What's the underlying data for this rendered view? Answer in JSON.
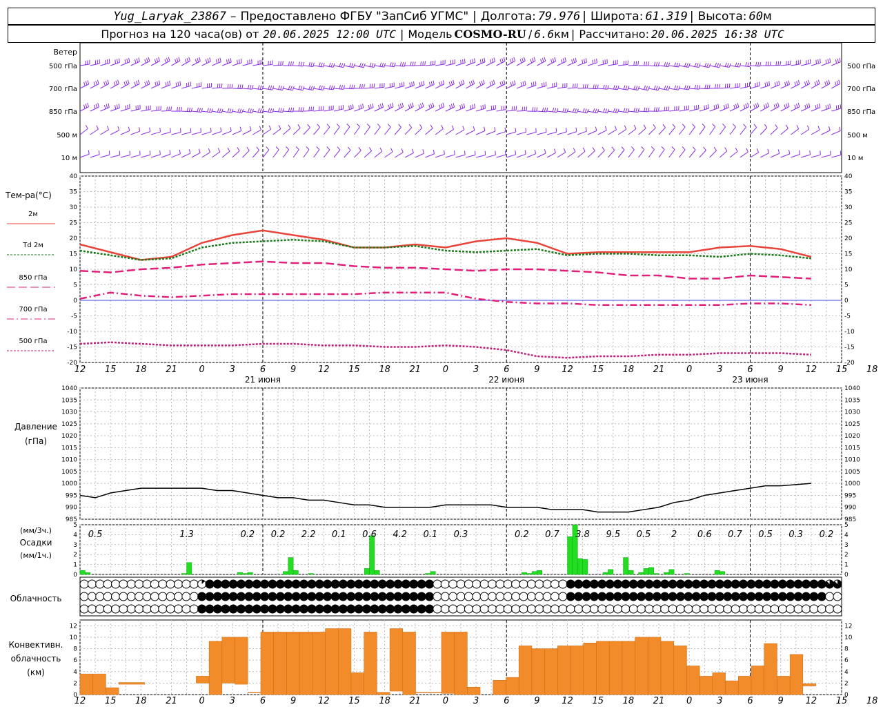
{
  "header": {
    "station": "Yug_Laryak_23867",
    "dash": "–",
    "provider": "Предоставлено ФГБУ \"ЗапСиб УГМС\"",
    "lon_label": "Долгота:",
    "lon_value": "79.976",
    "lat_label": "Широта:",
    "lat_value": "61.319",
    "alt_label": "Высота:",
    "alt_value": "60",
    "alt_unit": "м",
    "forecast_label": "Прогноз на 120 часа(ов) от",
    "forecast_from": "20.06.2025 12:00 UTC",
    "model_label": "Модель",
    "model_name": "COSMO-RU",
    "model_res": "6.6",
    "model_res_unit": "км",
    "calc_label": "Рассчитано:",
    "calc_value": "20.06.2025 16:38 UTC",
    "sep": "|"
  },
  "chart_data": [
    {
      "type": "wind-barbs",
      "panel_label": "Ветер",
      "levels": [
        "500 гПа",
        "700 гПа",
        "850 гПа",
        "500 м",
        "10 м"
      ]
    },
    {
      "type": "line",
      "panel_label": "Тем-ра(°C)",
      "ylim": [
        -20,
        40
      ],
      "yticks": [
        -20,
        -15,
        -10,
        -5,
        0,
        5,
        10,
        15,
        20,
        25,
        30,
        35,
        40
      ],
      "x_hour_labels": [
        "12",
        "15",
        "18",
        "21",
        "0",
        "3",
        "6",
        "9",
        "12",
        "15",
        "18",
        "21",
        "0",
        "3",
        "6",
        "9",
        "12",
        "15",
        "18",
        "21",
        "0",
        "3",
        "6",
        "9",
        "12",
        "15",
        "18"
      ],
      "date_labels": [
        {
          "text": "21 июня",
          "x": 36
        },
        {
          "text": "22 июня",
          "x": 84
        },
        {
          "text": "23 июня",
          "x": 132
        }
      ],
      "series": [
        {
          "name": "2м",
          "color": "#e8443a",
          "dash": "solid",
          "x": [
            0,
            6,
            12,
            18,
            24,
            30,
            36,
            42,
            48,
            54,
            60,
            66,
            72,
            78,
            84,
            90,
            96,
            102,
            108,
            114,
            120,
            126,
            132,
            138,
            144
          ],
          "y": [
            18,
            15.5,
            13,
            14,
            18.5,
            21,
            22.5,
            21,
            19.5,
            17,
            17,
            18,
            17,
            19,
            20,
            18.5,
            15,
            15.5,
            15.5,
            15.5,
            15.5,
            17,
            17.5,
            16.5,
            14
          ]
        },
        {
          "name": "Td 2м",
          "color": "#1a7a1a",
          "dash": "3,2",
          "x": [
            0,
            6,
            12,
            18,
            24,
            30,
            36,
            42,
            48,
            54,
            60,
            66,
            72,
            78,
            84,
            90,
            96,
            102,
            108,
            114,
            120,
            126,
            132,
            138,
            144
          ],
          "y": [
            16,
            14.5,
            13,
            13.5,
            17,
            18.5,
            19,
            19.5,
            19,
            17,
            17,
            17.5,
            16,
            15.5,
            16,
            16.5,
            14.5,
            15,
            15,
            14.5,
            14.5,
            14,
            15,
            14.5,
            13.5
          ]
        },
        {
          "name": "850 гПа",
          "color": "#e0207a",
          "dash": "12,5",
          "x": [
            0,
            6,
            12,
            18,
            24,
            30,
            36,
            42,
            48,
            54,
            60,
            66,
            72,
            78,
            84,
            90,
            96,
            102,
            108,
            114,
            120,
            126,
            132,
            138,
            144
          ],
          "y": [
            9.5,
            9,
            10,
            10.5,
            11.5,
            12,
            12.5,
            12,
            12,
            11,
            10.5,
            10.5,
            10,
            9.5,
            10,
            10,
            9.5,
            9,
            8,
            8,
            7,
            7,
            8,
            7.5,
            7
          ]
        },
        {
          "name": "700 гПа",
          "color": "#e0207a",
          "dash": "10,4,2,4",
          "x": [
            0,
            6,
            12,
            18,
            24,
            30,
            36,
            42,
            48,
            54,
            60,
            66,
            72,
            78,
            84,
            90,
            96,
            102,
            108,
            114,
            120,
            126,
            132,
            138,
            144
          ],
          "y": [
            0.5,
            2.5,
            1.5,
            1,
            1.5,
            2,
            2,
            2,
            2,
            2,
            2.5,
            2.5,
            2.5,
            0.5,
            -0.5,
            -1,
            -1,
            -1.5,
            -1.5,
            -1.5,
            -1.5,
            -1.5,
            -1,
            -1,
            -1.5
          ]
        },
        {
          "name": "500 гПа",
          "color": "#c0207a",
          "dash": "3,2",
          "x": [
            0,
            6,
            12,
            18,
            24,
            30,
            36,
            42,
            48,
            54,
            60,
            66,
            72,
            78,
            84,
            90,
            96,
            102,
            108,
            114,
            120,
            126,
            132,
            138,
            144
          ],
          "y": [
            -14,
            -13.5,
            -14,
            -14.5,
            -14.5,
            -14.5,
            -14,
            -14,
            -14.5,
            -14.5,
            -15,
            -15,
            -14.5,
            -15,
            -16,
            -18,
            -18.5,
            -18,
            -18,
            -17.5,
            -17.5,
            -17,
            -17,
            -17,
            -17.5
          ]
        }
      ]
    },
    {
      "type": "line",
      "panel_label_1": "Давление",
      "panel_label_2": "(гПа)",
      "ylim": [
        985,
        1040
      ],
      "yticks": [
        985,
        990,
        995,
        1000,
        1005,
        1010,
        1015,
        1020,
        1025,
        1030,
        1035,
        1040
      ],
      "series": [
        {
          "name": "",
          "color": "#000000",
          "x": [
            0,
            3,
            6,
            9,
            12,
            15,
            18,
            21,
            24,
            27,
            30,
            33,
            36,
            39,
            42,
            45,
            48,
            51,
            54,
            57,
            60,
            63,
            66,
            69,
            72,
            75,
            78,
            81,
            84,
            87,
            90,
            93,
            96,
            99,
            102,
            105,
            108,
            111,
            114,
            117,
            120,
            123,
            126,
            129,
            132,
            135,
            138,
            141,
            144
          ],
          "y": [
            995,
            994,
            996,
            997,
            998,
            998,
            998,
            998,
            998,
            997,
            997,
            996,
            995,
            994,
            994,
            993,
            993,
            992,
            991,
            991,
            990,
            990,
            990,
            990,
            991,
            991,
            991,
            991,
            990,
            990,
            990,
            989,
            989,
            989,
            988,
            988,
            988,
            989,
            990,
            992,
            993,
            995,
            996,
            997,
            998,
            999,
            999,
            999.5,
            1000
          ]
        }
      ]
    },
    {
      "type": "bar",
      "panel_label_1": "(мм/3ч.)",
      "panel_label_2": "Осадки",
      "panel_label_3": "(мм/1ч.)",
      "ylim": [
        0,
        5
      ],
      "yticks": [
        0,
        1,
        2,
        3,
        4,
        5
      ],
      "totals_3h": [
        {
          "x": 3,
          "text": "0.5"
        },
        {
          "x": 21,
          "text": "1.3"
        },
        {
          "x": 33,
          "text": "0.2"
        },
        {
          "x": 39,
          "text": "0.2"
        },
        {
          "x": 45,
          "text": "2.2"
        },
        {
          "x": 51,
          "text": "0.1"
        },
        {
          "x": 57,
          "text": "0.6"
        },
        {
          "x": 63,
          "text": "4.2"
        },
        {
          "x": 69,
          "text": "0.1"
        },
        {
          "x": 75,
          "text": "0.3"
        },
        {
          "x": 87,
          "text": "0.2"
        },
        {
          "x": 93,
          "text": "0.7"
        },
        {
          "x": 99,
          "text": "3.8"
        },
        {
          "x": 105,
          "text": "9.5"
        },
        {
          "x": 111,
          "text": "0.5"
        },
        {
          "x": 117,
          "text": "2"
        },
        {
          "x": 123,
          "text": "0.6"
        },
        {
          "x": 129,
          "text": "0.7"
        },
        {
          "x": 135,
          "text": "0.5"
        },
        {
          "x": 141,
          "text": "0.3"
        },
        {
          "x": 147,
          "text": "0.2"
        }
      ],
      "hourly": [
        {
          "x": 0,
          "v": 0.4
        },
        {
          "x": 1,
          "v": 0.2
        },
        {
          "x": 20,
          "v": 0.1
        },
        {
          "x": 21,
          "v": 1.2
        },
        {
          "x": 31,
          "v": 0.2
        },
        {
          "x": 32,
          "v": 0.1
        },
        {
          "x": 33,
          "v": 0.2
        },
        {
          "x": 40,
          "v": 0.3
        },
        {
          "x": 41,
          "v": 1.7
        },
        {
          "x": 42,
          "v": 0.4
        },
        {
          "x": 45,
          "v": 0.1
        },
        {
          "x": 56,
          "v": 0.6
        },
        {
          "x": 57,
          "v": 3.9
        },
        {
          "x": 58,
          "v": 0.4
        },
        {
          "x": 68,
          "v": 0.1
        },
        {
          "x": 69,
          "v": 0.3
        },
        {
          "x": 87,
          "v": 0.2
        },
        {
          "x": 88,
          "v": 0.1
        },
        {
          "x": 89,
          "v": 0.3
        },
        {
          "x": 90,
          "v": 0.4
        },
        {
          "x": 96,
          "v": 3.8
        },
        {
          "x": 97,
          "v": 5.8
        },
        {
          "x": 98,
          "v": 1.6
        },
        {
          "x": 99,
          "v": 1.5
        },
        {
          "x": 103,
          "v": 0.2
        },
        {
          "x": 104,
          "v": 0.5
        },
        {
          "x": 107,
          "v": 1.7
        },
        {
          "x": 108,
          "v": 0.4
        },
        {
          "x": 110,
          "v": 0.2
        },
        {
          "x": 111,
          "v": 0.6
        },
        {
          "x": 112,
          "v": 0.7
        },
        {
          "x": 113,
          "v": 0.1
        },
        {
          "x": 115,
          "v": 0.2
        },
        {
          "x": 116,
          "v": 0.5
        },
        {
          "x": 119,
          "v": 0.1
        },
        {
          "x": 125,
          "v": 0.4
        },
        {
          "x": 126,
          "v": 0.3
        }
      ]
    },
    {
      "type": "cloud-cover",
      "panel_label": "Облачность",
      "rows": [
        "0000000000000001888888888888888888888888888880000000000000000088888888888888888888888888888888877",
        "0000000000000008888888888888888888888888888880000000000000000088888888888888888888888888888888800",
        "0000000000000008888888888888888888888888888880000000000000000000000000000000000000000000000000000"
      ]
    },
    {
      "type": "bar",
      "panel_label_1": "Конвективн.",
      "panel_label_2": "облачность",
      "panel_label_3": "(км)",
      "ylim": [
        0,
        13
      ],
      "yticks": [
        0,
        2,
        4,
        6,
        8,
        10,
        12
      ],
      "segments": [
        {
          "x0": 0,
          "x1": 1,
          "base": 0,
          "top": 3.6
        },
        {
          "x0": 1,
          "x1": 2,
          "base": 0,
          "top": 3.6
        },
        {
          "x0": 2,
          "x1": 3,
          "base": 0,
          "top": 1.2
        },
        {
          "x0": 3,
          "x1": 5,
          "base": 1.8,
          "top": 2.1
        },
        {
          "x0": 9,
          "x1": 10,
          "base": 2.0,
          "top": 3.2
        },
        {
          "x0": 10,
          "x1": 11,
          "base": 0,
          "top": 9.3
        },
        {
          "x0": 11,
          "x1": 12,
          "base": 2,
          "top": 10.0
        },
        {
          "x0": 12,
          "x1": 13,
          "base": 1.8,
          "top": 10.0
        },
        {
          "x0": 13,
          "x1": 14,
          "base": 0.3,
          "top": 0.4
        },
        {
          "x0": 14,
          "x1": 15,
          "base": 0,
          "top": 10.9
        },
        {
          "x0": 15,
          "x1": 16,
          "base": 0,
          "top": 10.9
        },
        {
          "x0": 16,
          "x1": 17,
          "base": 0,
          "top": 10.9
        },
        {
          "x0": 17,
          "x1": 18,
          "base": 0,
          "top": 10.9
        },
        {
          "x0": 18,
          "x1": 19,
          "base": 0,
          "top": 10.9
        },
        {
          "x0": 19,
          "x1": 20,
          "base": 0,
          "top": 11.5
        },
        {
          "x0": 20,
          "x1": 21,
          "base": 0,
          "top": 11.5
        },
        {
          "x0": 21,
          "x1": 22,
          "base": 0,
          "top": 3.8
        },
        {
          "x0": 22,
          "x1": 23,
          "base": 0,
          "top": 10.9
        },
        {
          "x0": 23,
          "x1": 24,
          "base": 0,
          "top": 0.4
        },
        {
          "x0": 24,
          "x1": 25,
          "base": 0.6,
          "top": 11.5
        },
        {
          "x0": 25,
          "x1": 26,
          "base": 0,
          "top": 10.9
        },
        {
          "x0": 26,
          "x1": 27,
          "base": 0.3,
          "top": 0.4
        },
        {
          "x0": 27,
          "x1": 28,
          "base": 0.3,
          "top": 0.4
        },
        {
          "x0": 28,
          "x1": 29,
          "base": 0.2,
          "top": 10.9
        },
        {
          "x0": 29,
          "x1": 30,
          "base": 0,
          "top": 10.9
        },
        {
          "x0": 30,
          "x1": 31,
          "base": 0,
          "top": 1.3
        },
        {
          "x0": 32,
          "x1": 33,
          "base": 0,
          "top": 2.5
        },
        {
          "x0": 33,
          "x1": 34,
          "base": 0,
          "top": 3.0
        },
        {
          "x0": 34,
          "x1": 35,
          "base": 0,
          "top": 8.5
        },
        {
          "x0": 35,
          "x1": 36,
          "base": 0,
          "top": 8.0
        },
        {
          "x0": 36,
          "x1": 37,
          "base": 0,
          "top": 8.0
        },
        {
          "x0": 37,
          "x1": 38,
          "base": 0,
          "top": 8.5
        },
        {
          "x0": 38,
          "x1": 39,
          "base": 0,
          "top": 8.5
        },
        {
          "x0": 39,
          "x1": 40,
          "base": 0,
          "top": 9.0
        },
        {
          "x0": 40,
          "x1": 41,
          "base": 0,
          "top": 9.3
        },
        {
          "x0": 41,
          "x1": 42,
          "base": 0,
          "top": 9.3
        },
        {
          "x0": 42,
          "x1": 43,
          "base": 0,
          "top": 9.3
        },
        {
          "x0": 43,
          "x1": 44,
          "base": 0,
          "top": 10.0
        },
        {
          "x0": 44,
          "x1": 45,
          "base": 0,
          "top": 10.0
        },
        {
          "x0": 45,
          "x1": 46,
          "base": 0,
          "top": 9.3
        },
        {
          "x0": 46,
          "x1": 47,
          "base": 0,
          "top": 8.5
        },
        {
          "x0": 47,
          "x1": 48,
          "base": 0,
          "top": 5.0
        },
        {
          "x0": 48,
          "x1": 49,
          "base": 0,
          "top": 3.2
        },
        {
          "x0": 49,
          "x1": 50,
          "base": 0,
          "top": 3.8
        },
        {
          "x0": 50,
          "x1": 51,
          "base": 0,
          "top": 2.4
        },
        {
          "x0": 51,
          "x1": 52,
          "base": 0,
          "top": 3.2
        },
        {
          "x0": 52,
          "x1": 53,
          "base": 0,
          "top": 5.0
        },
        {
          "x0": 53,
          "x1": 54,
          "base": 0,
          "top": 8.9
        },
        {
          "x0": 54,
          "x1": 55,
          "base": 0,
          "top": 3.2
        },
        {
          "x0": 55,
          "x1": 56,
          "base": 0,
          "top": 7.0
        },
        {
          "x0": 56,
          "x1": 57,
          "base": 1.5,
          "top": 1.9
        }
      ]
    }
  ]
}
